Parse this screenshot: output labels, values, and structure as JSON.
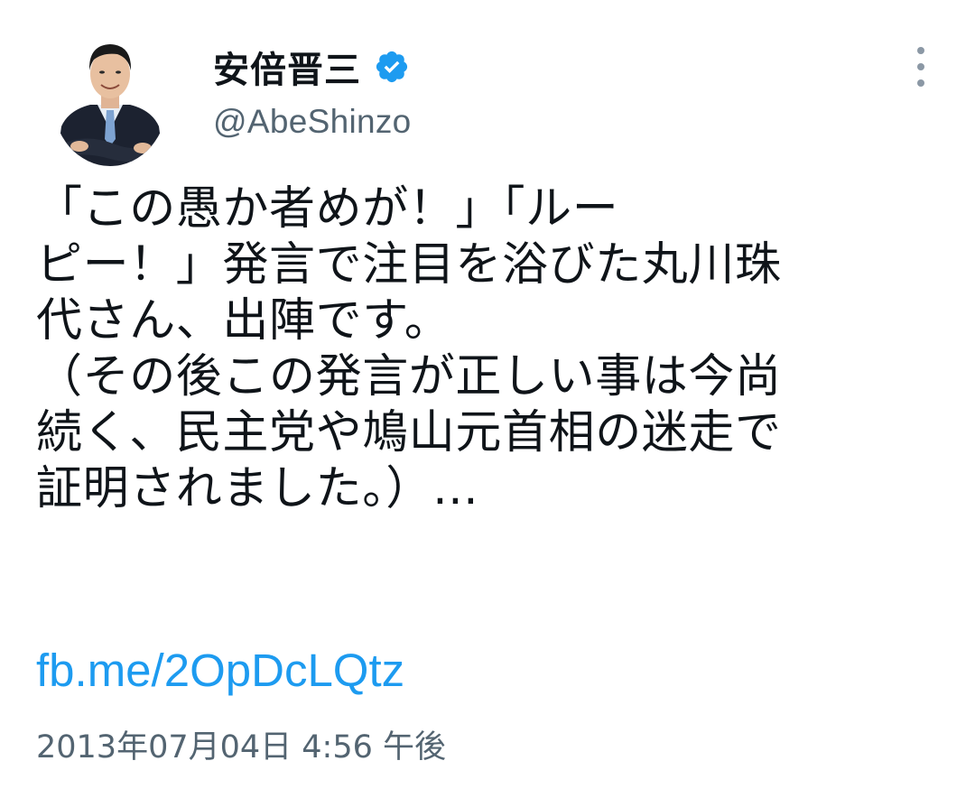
{
  "author": {
    "display_name": "安倍晋三",
    "handle": "@AbeShinzo",
    "verified": true,
    "avatar_icon": "profile-photo-avatar"
  },
  "menu": {
    "icon": "more-vertical-icon"
  },
  "tweet": {
    "lines": [
      "「この愚か者めが！」「ルー",
      "ピー！」発言で注目を浴びた丸川珠",
      "代さん、出陣です。",
      "（その後この発言が正しい事は今尚",
      "続く、民主党や鳩山元首相の迷走で",
      "証明されました。）…"
    ],
    "link": "fb.me/2OpDcLQtz",
    "timestamp": "2013年07月04日 4:56 午後"
  },
  "colors": {
    "text": "#0f1419",
    "secondary": "#536471",
    "link": "#1d9bf0",
    "verified_badge": "#1d9bf0"
  }
}
